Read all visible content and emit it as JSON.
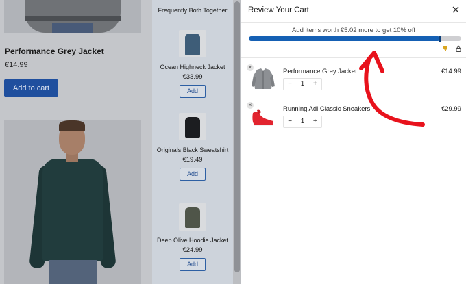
{
  "page": {
    "product_title": "Performance Grey Jacket",
    "product_price": "€14.99",
    "add_to_cart_label": "Add to cart"
  },
  "fbt": {
    "title": "Frequently Both Together",
    "items": [
      {
        "name": "Ocean Highneck Jacket",
        "price": "€33.99",
        "add_label": "Add",
        "icon": "jacket-thumbnail"
      },
      {
        "name": "Originals Black Sweatshirt",
        "price": "€19.49",
        "add_label": "Add",
        "icon": "sweatshirt-thumbnail"
      },
      {
        "name": "Deep Olive Hoodie Jacket",
        "price": "€24.99",
        "add_label": "Add",
        "icon": "hoodie-thumbnail"
      }
    ]
  },
  "cart": {
    "title": "Review Your Cart",
    "close_icon": "close-icon",
    "progress_message": "Add items worth €5.02 more to get 10% off",
    "progress_fraction": 0.9,
    "accent_color": "#1560b4",
    "items": [
      {
        "name": "Performance Grey Jacket",
        "price": "€14.99",
        "qty": "1",
        "minus": "−",
        "plus": "+",
        "remove": "×"
      },
      {
        "name": "Running Adi Classic Sneakers",
        "price": "€29.99",
        "qty": "1",
        "minus": "−",
        "plus": "+",
        "remove": "×"
      }
    ]
  },
  "annotation_color": "#e8121c"
}
